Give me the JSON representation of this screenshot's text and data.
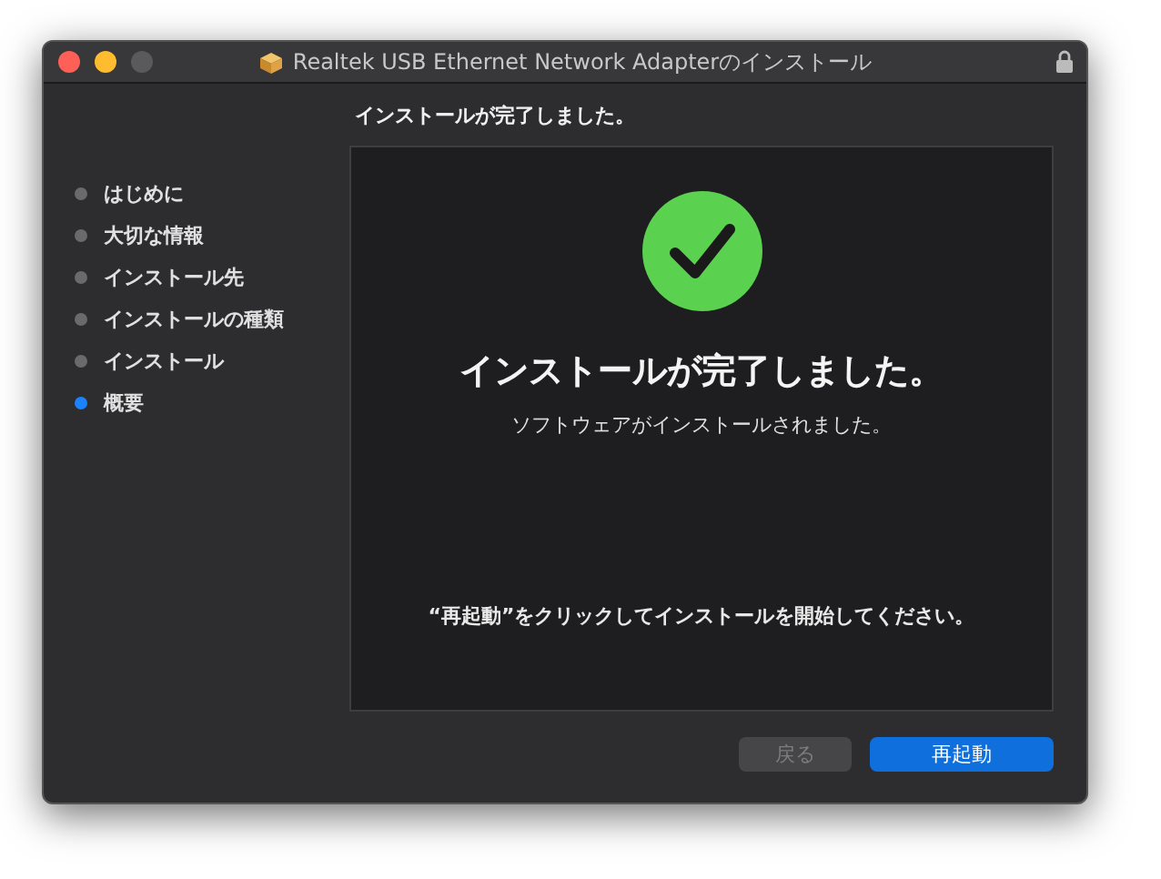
{
  "window": {
    "title": "Realtek USB Ethernet Network Adapterのインストール"
  },
  "header": "インストールが完了しました。",
  "steps": [
    {
      "label": "はじめに",
      "selected": false
    },
    {
      "label": "大切な情報",
      "selected": false
    },
    {
      "label": "インストール先",
      "selected": false
    },
    {
      "label": "インストールの種類",
      "selected": false
    },
    {
      "label": "インストール",
      "selected": false
    },
    {
      "label": "概要",
      "selected": true
    }
  ],
  "panel": {
    "heading": "インストールが完了しました。",
    "subtext": "ソフトウェアがインストールされました。",
    "instruction": "“再起動”をクリックしてインストールを開始してください。"
  },
  "buttons": [
    {
      "label": "戻る",
      "disabled": true,
      "kind": "secondary"
    },
    {
      "label": "再起動",
      "disabled": false,
      "kind": "primary"
    }
  ]
}
